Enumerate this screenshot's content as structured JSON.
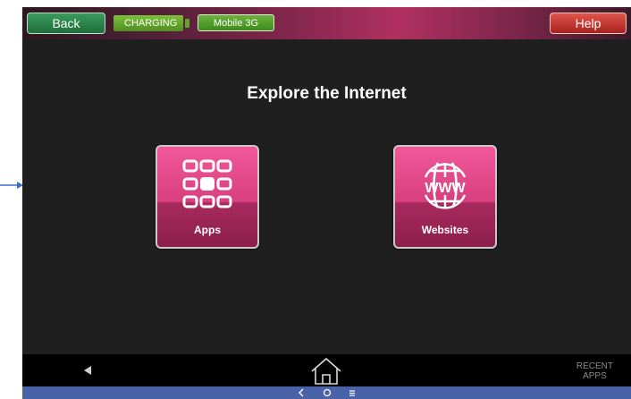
{
  "topbar": {
    "back_label": "Back",
    "help_label": "Help",
    "battery_status": "CHARGING",
    "network_label": "Mobile 3G"
  },
  "main": {
    "title": "Explore the Internet",
    "tiles": [
      {
        "label": "Apps",
        "icon": "apps-grid-icon"
      },
      {
        "label": "Websites",
        "icon": "www-globe-icon"
      }
    ]
  },
  "navbar": {
    "recent_line1": "RECENT",
    "recent_line2": "APPS"
  },
  "colors": {
    "screen_bg": "#1f1f1f",
    "tile_pink": "#e0488a",
    "back_green": "#2a8048",
    "help_red": "#c8322a",
    "system_bar": "#4a63a8"
  }
}
